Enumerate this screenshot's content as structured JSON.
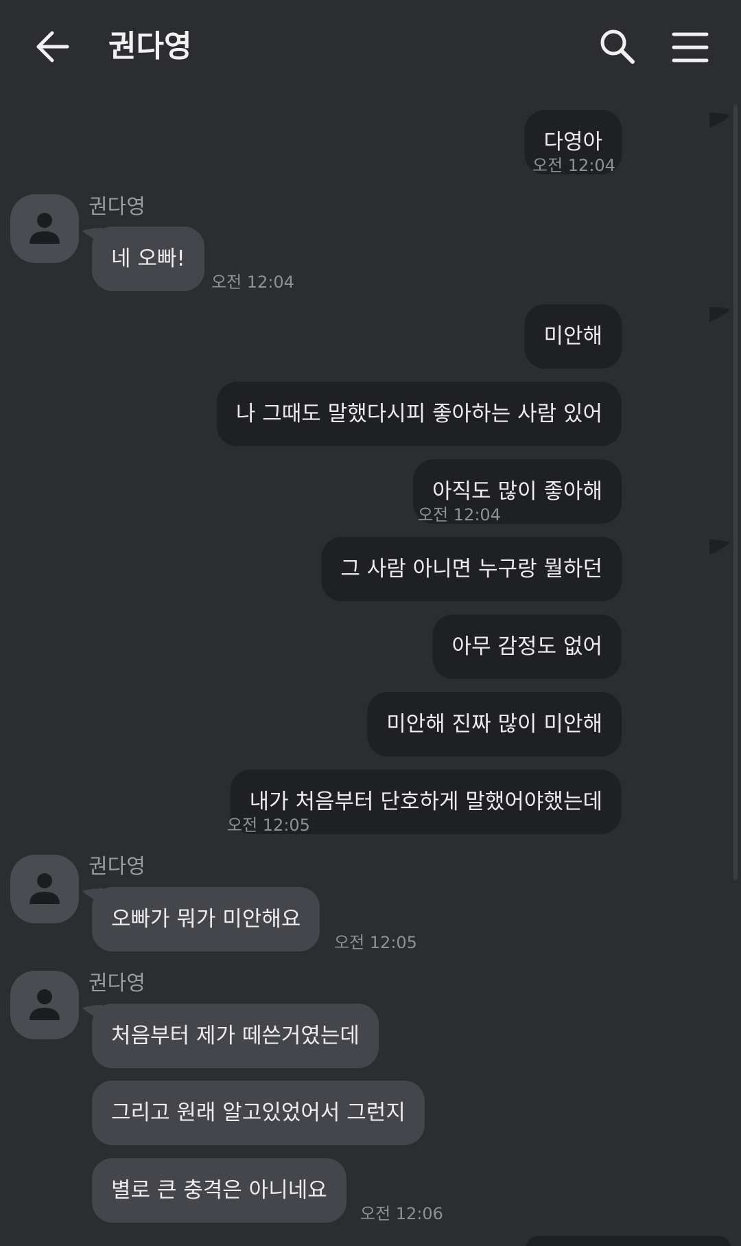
{
  "header": {
    "title": "권다영"
  },
  "icons": {
    "back": "arrow-left-icon",
    "search": "search-icon",
    "menu": "hamburger-menu-icon",
    "avatar": "person-icon"
  },
  "colors": {
    "background": "#2b2d31",
    "my_bubble": "#1f2024",
    "their_bubble": "#44464c",
    "text": "#ececec",
    "timestamp": "#8e9095"
  },
  "messages": [
    {
      "from": "me",
      "text": "다영아",
      "time": "오전 12:04"
    },
    {
      "from": "them",
      "sender": "권다영",
      "text": "네 오빠!",
      "time": "오전 12:04"
    },
    {
      "from": "me",
      "text": "미안해"
    },
    {
      "from": "me",
      "text": "나 그때도 말했다시피 좋아하는 사람 있어"
    },
    {
      "from": "me",
      "text": "아직도 많이 좋아해",
      "time": "오전 12:04"
    },
    {
      "from": "me",
      "text": "그 사람 아니면 누구랑 뭘하던"
    },
    {
      "from": "me",
      "text": "아무 감정도 없어"
    },
    {
      "from": "me",
      "text": "미안해 진짜 많이 미안해"
    },
    {
      "from": "me",
      "text": "내가 처음부터 단호하게 말했어야했는데",
      "time": "오전 12:05"
    },
    {
      "from": "them",
      "sender": "권다영",
      "text": "오빠가 뭐가 미안해요",
      "time": "오전 12:05"
    },
    {
      "from": "them",
      "sender": "권다영",
      "text": "처음부터 제가 떼쓴거였는데"
    },
    {
      "from": "them",
      "text": "그리고 원래 알고있었어서 그런지"
    },
    {
      "from": "them",
      "text": "별로 큰 충격은 아니네요",
      "time": "오전 12:06"
    }
  ]
}
